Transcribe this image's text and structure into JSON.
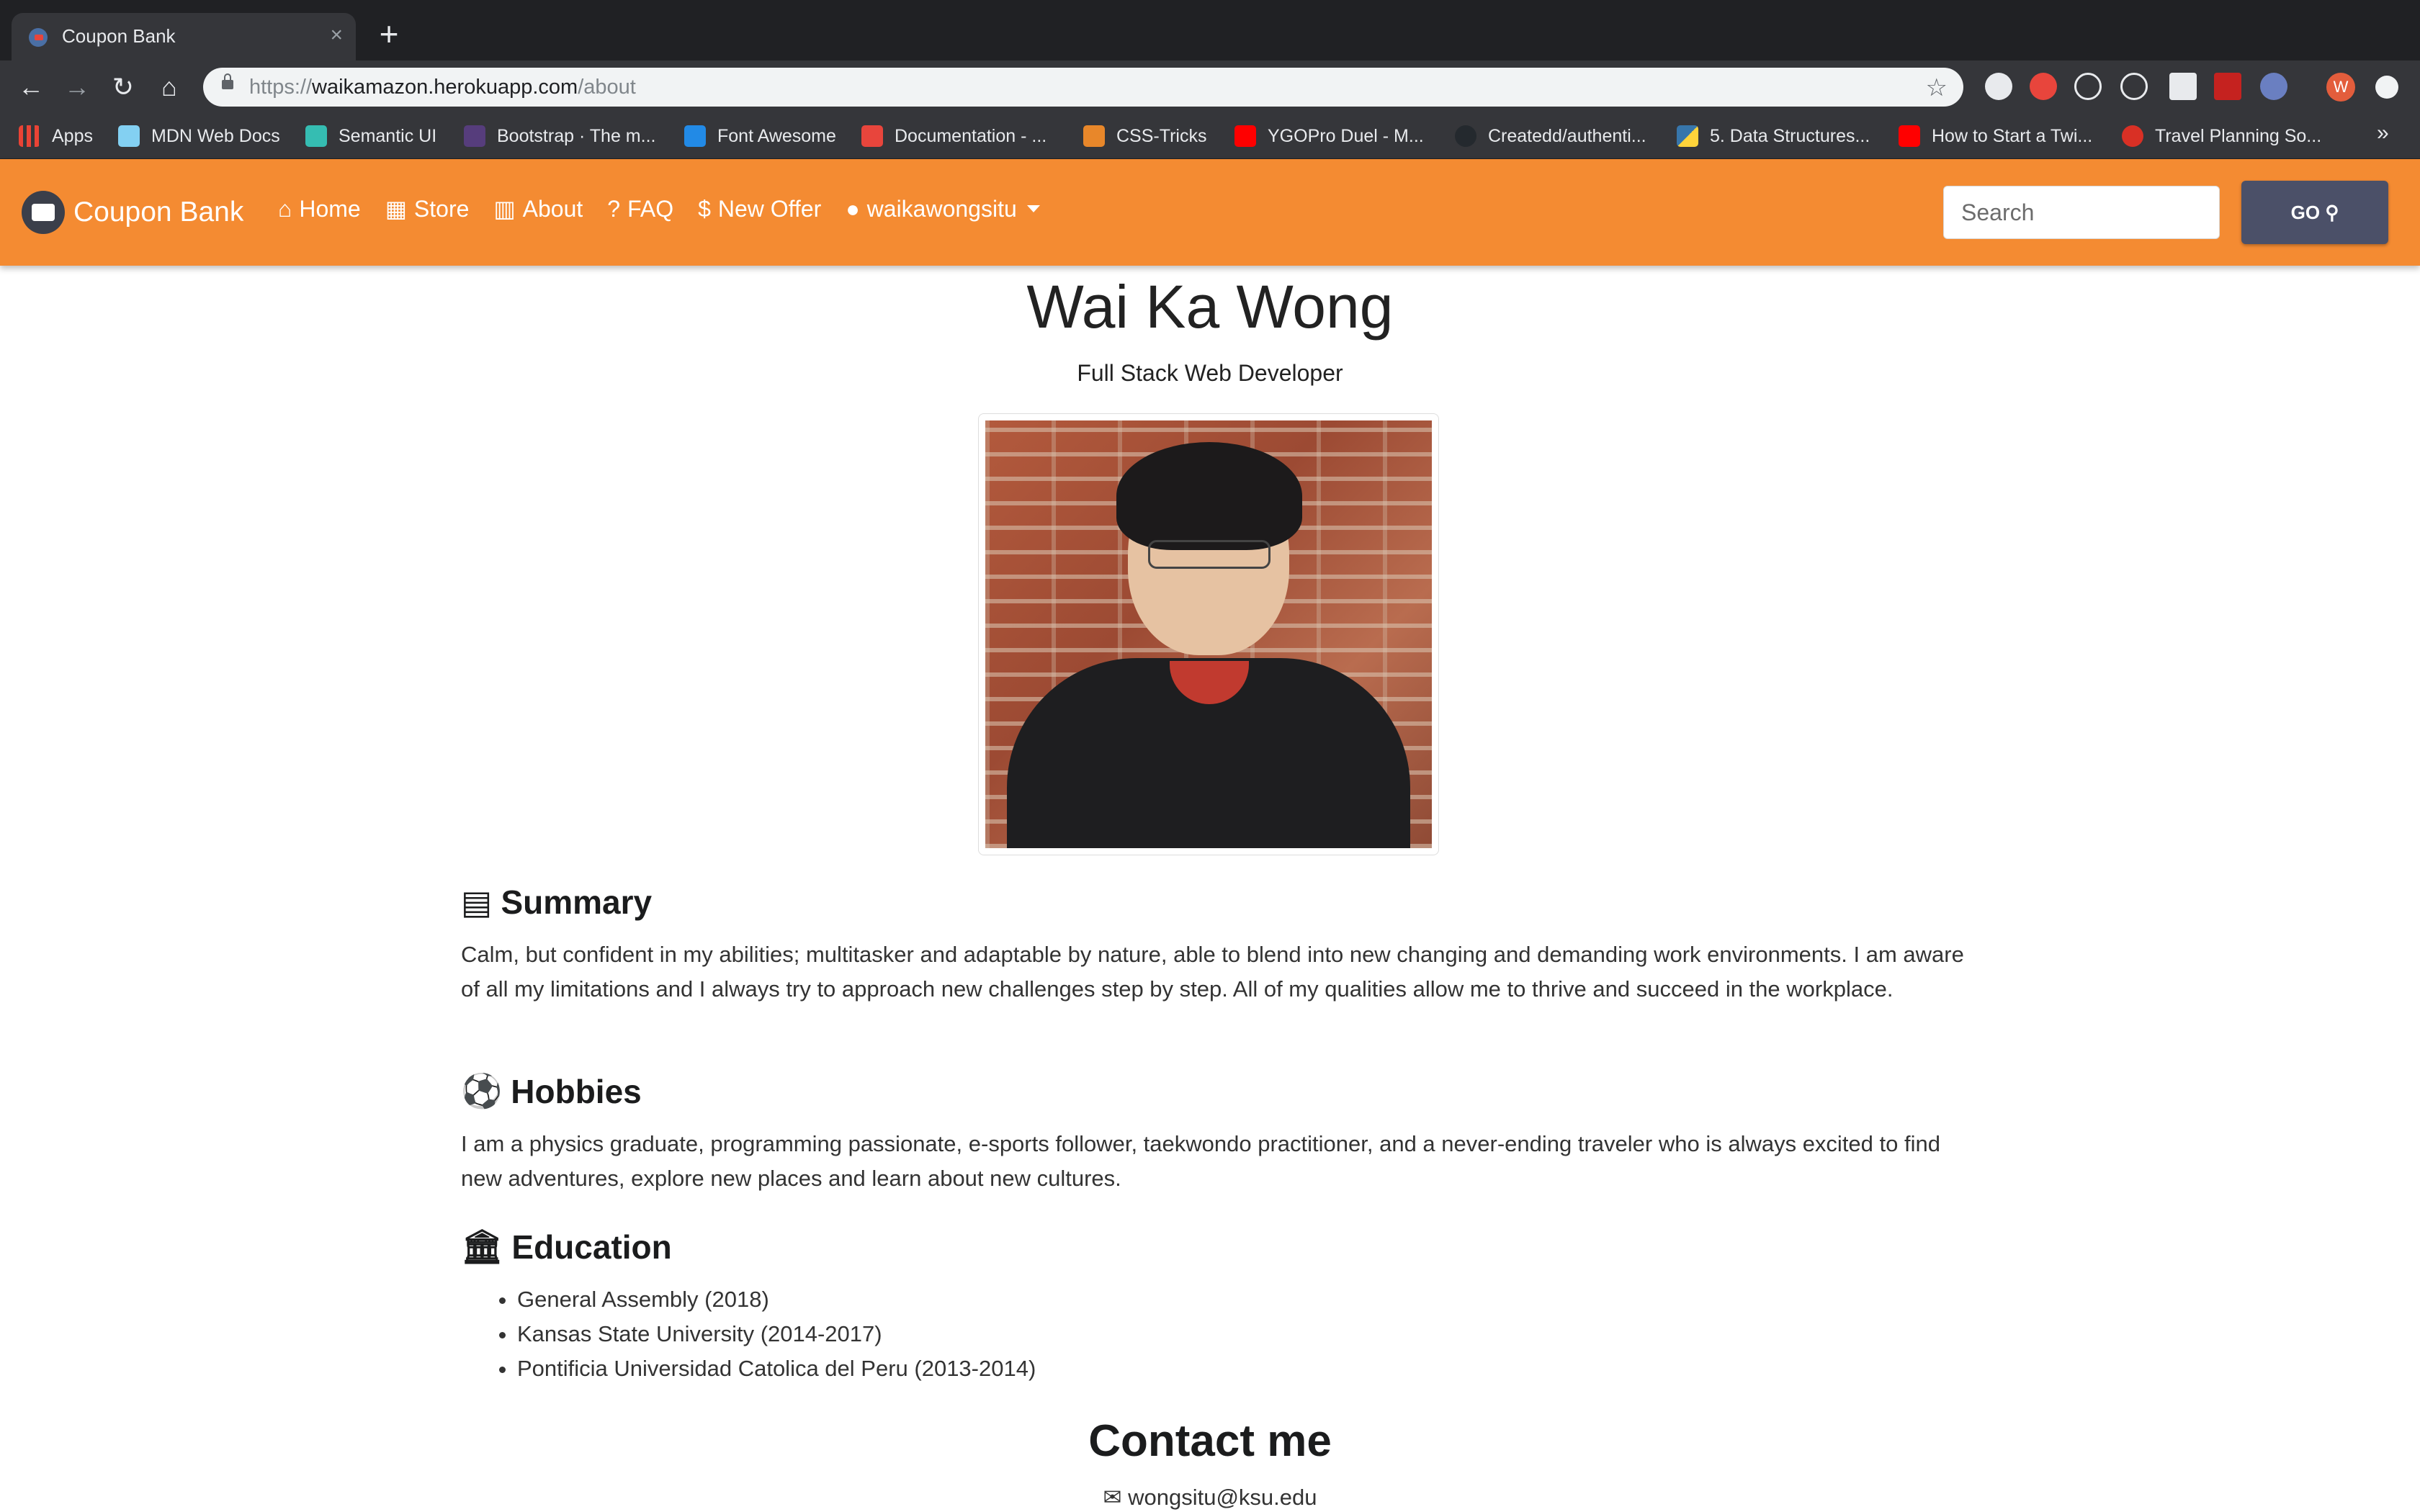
{
  "browser": {
    "tab_title": "Coupon Bank",
    "tab_close": "×",
    "new_tab": "+",
    "url_prefix": "https://",
    "url_host": "waikamazon.herokuapp.com",
    "url_path": "/about",
    "profile_initial": "W",
    "bookmarks": [
      {
        "label": "Apps",
        "icon": "apps-grid-icon",
        "color": "#ea4335"
      },
      {
        "label": "MDN Web Docs",
        "icon": "mdn-icon",
        "color": "#83d0f2"
      },
      {
        "label": "Semantic UI",
        "icon": "semantic-ui-icon",
        "color": "#35bdb2"
      },
      {
        "label": "Bootstrap · The m...",
        "icon": "bootstrap-icon",
        "color": "#563d7c"
      },
      {
        "label": "Font Awesome",
        "icon": "font-awesome-icon",
        "color": "#228ae6"
      },
      {
        "label": "Documentation - ...",
        "icon": "documentation-icon",
        "color": "#e8453c"
      },
      {
        "label": "CSS-Tricks",
        "icon": "css-tricks-icon",
        "color": "#e8872a"
      },
      {
        "label": "YGOPro Duel - M...",
        "icon": "youtube-icon",
        "color": "#ff0000"
      },
      {
        "label": "Createdd/authenti...",
        "icon": "github-icon",
        "color": "#24292e"
      },
      {
        "label": "5. Data Structures...",
        "icon": "python-icon",
        "color": "#3776ab"
      },
      {
        "label": "How to Start a Twi...",
        "icon": "youtube-icon",
        "color": "#ff0000"
      },
      {
        "label": "Travel Planning So...",
        "icon": "travel-icon",
        "color": "#d93025"
      }
    ],
    "bookmarks_more": "»"
  },
  "navbar": {
    "brand": "Coupon Bank",
    "accent_color": "#f48b32",
    "links": [
      {
        "label": "Home",
        "icon": "home-icon"
      },
      {
        "label": "Store",
        "icon": "store-icon"
      },
      {
        "label": "About",
        "icon": "building-icon"
      },
      {
        "label": "FAQ",
        "icon": "question-circle-icon"
      },
      {
        "label": "New Offer",
        "icon": "hand-holding-dollar-icon"
      }
    ],
    "user": {
      "label": "waikawongsitu",
      "icon": "user-icon"
    },
    "search_placeholder": "Search",
    "go_label": "GO"
  },
  "profile": {
    "name": "Wai Ka Wong",
    "title": "Full Stack Web Developer"
  },
  "summary": {
    "heading": "Summary",
    "text": "Calm, but confident in my abilities; multitasker and adaptable by nature, able to blend into new changing and demanding work environments. I am aware of all my limitations and I always try to approach new challenges step by step. All of my qualities allow me to thrive and succeed in the workplace."
  },
  "hobbies": {
    "heading": "Hobbies",
    "text": "I am a physics graduate, programming passionate, e-sports follower, taekwondo practitioner, and a never-ending traveler who is always excited to find new adventures, explore new places and learn about new cultures."
  },
  "education": {
    "heading": "Education",
    "items": [
      "General Assembly (2018)",
      "Kansas State University (2014-2017)",
      "Pontificia Universidad Catolica del Peru (2013-2014)"
    ]
  },
  "contact": {
    "heading": "Contact me",
    "email": "wongsitu@ksu.edu"
  }
}
